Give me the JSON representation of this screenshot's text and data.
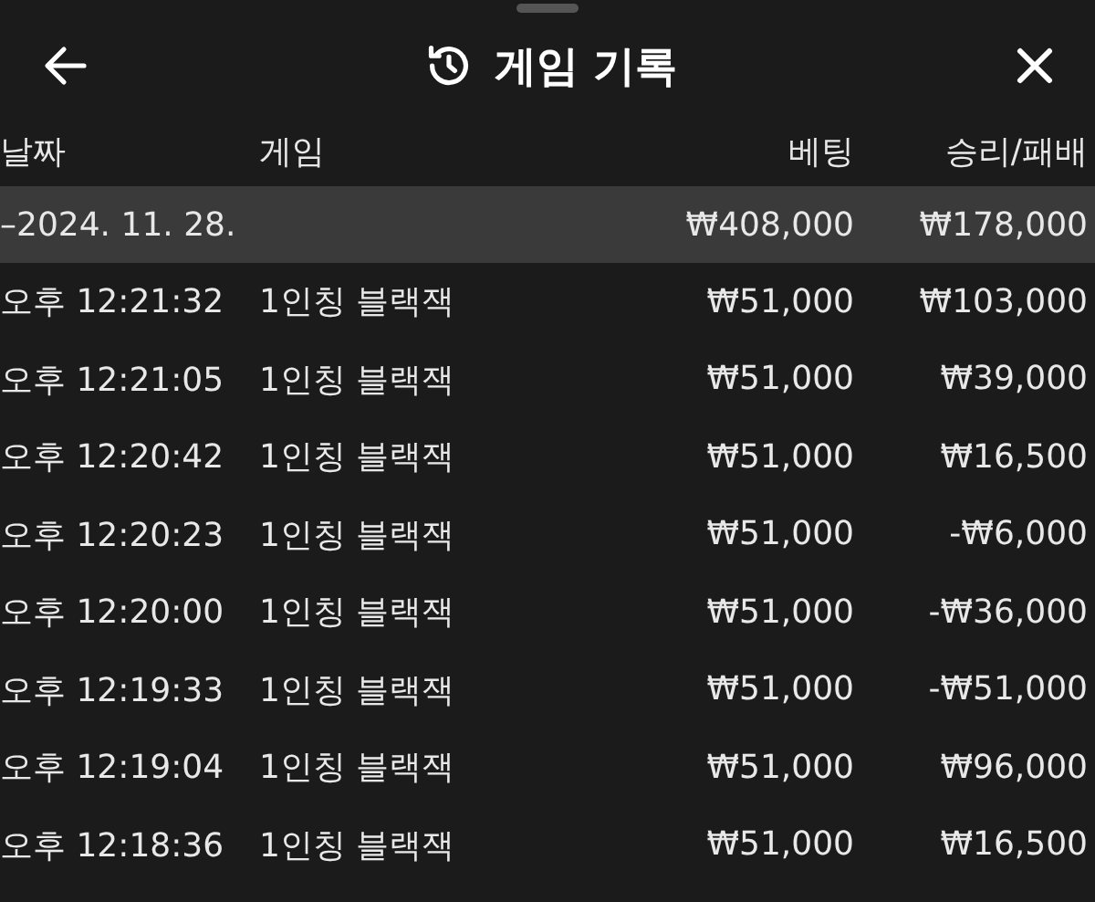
{
  "header": {
    "title": "게임 기록"
  },
  "columns": [
    "날짜",
    "게임",
    "베팅",
    "승리/패배"
  ],
  "summary": {
    "date": "–2024. 11. 28.",
    "bet": "₩408,000",
    "result": "₩178,000"
  },
  "rows": [
    {
      "time": "오후 12:21:32",
      "game": "1인칭 블랙잭",
      "bet": "₩51,000",
      "result": "₩103,000"
    },
    {
      "time": "오후 12:21:05",
      "game": "1인칭 블랙잭",
      "bet": "₩51,000",
      "result": "₩39,000"
    },
    {
      "time": "오후 12:20:42",
      "game": "1인칭 블랙잭",
      "bet": "₩51,000",
      "result": "₩16,500"
    },
    {
      "time": "오후 12:20:23",
      "game": "1인칭 블랙잭",
      "bet": "₩51,000",
      "result": "-₩6,000"
    },
    {
      "time": "오후 12:20:00",
      "game": "1인칭 블랙잭",
      "bet": "₩51,000",
      "result": "-₩36,000"
    },
    {
      "time": "오후 12:19:33",
      "game": "1인칭 블랙잭",
      "bet": "₩51,000",
      "result": "-₩51,000"
    },
    {
      "time": "오후 12:19:04",
      "game": "1인칭 블랙잭",
      "bet": "₩51,000",
      "result": "₩96,000"
    },
    {
      "time": "오후 12:18:36",
      "game": "1인칭 블랙잭",
      "bet": "₩51,000",
      "result": "₩16,500"
    }
  ]
}
